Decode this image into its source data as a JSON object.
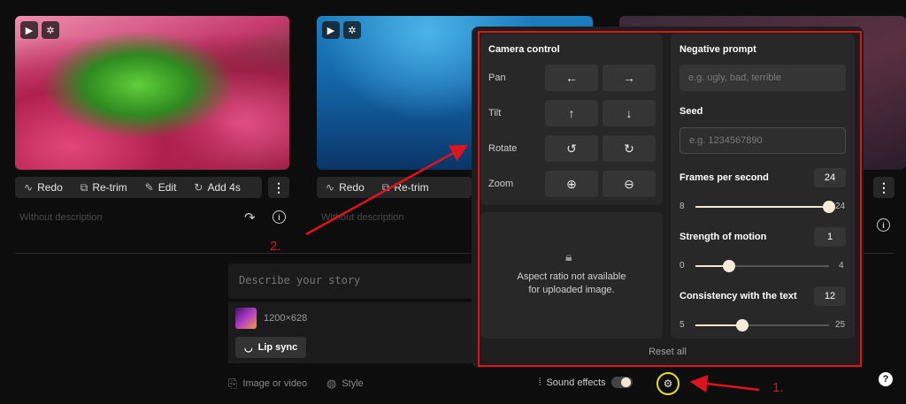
{
  "cards": [
    {
      "actions": [
        {
          "icon": "waveform-icon",
          "label": "Redo"
        },
        {
          "icon": "retrim-icon",
          "label": "Re-trim"
        },
        {
          "icon": "brush-icon",
          "label": "Edit"
        },
        {
          "icon": "rotate-clock-icon",
          "label": "Add 4s"
        }
      ],
      "description": "Without description"
    },
    {
      "actions": [
        {
          "icon": "waveform-icon",
          "label": "Redo"
        },
        {
          "icon": "retrim-icon",
          "label": "Re-trim"
        }
      ],
      "description": "Without description"
    }
  ],
  "prompt": {
    "placeholder": "Describe your story",
    "attachment_dims": "1200×628",
    "lip_sync_label": "Lip sync"
  },
  "bottom_bar": {
    "image_or_video": "Image or video",
    "style": "Style",
    "sound_effects": "Sound effects",
    "sound_effects_on": false
  },
  "camera": {
    "title": "Camera control",
    "rows": [
      {
        "label": "Pan",
        "left": "←",
        "right": "→"
      },
      {
        "label": "Tilt",
        "left": "↑",
        "right": "↓"
      },
      {
        "label": "Rotate",
        "left": "↺",
        "right": "↻"
      },
      {
        "label": "Zoom",
        "left": "⊕",
        "right": "⊖"
      }
    ]
  },
  "aspect": {
    "line1": "Aspect ratio not available",
    "line2": "for uploaded image."
  },
  "settings": {
    "negative_prompt_label": "Negative prompt",
    "negative_prompt_placeholder": "e.g. ugly, bad, terrible",
    "seed_label": "Seed",
    "seed_placeholder": "e.g. 1234567890",
    "fps": {
      "label": "Frames per second",
      "value": "24",
      "min": "8",
      "max": "24",
      "num": 24,
      "lo": 8,
      "hi": 24
    },
    "motion": {
      "label": "Strength of motion",
      "value": "1",
      "min": "0",
      "max": "4",
      "num": 1,
      "lo": 0,
      "hi": 4
    },
    "consistency": {
      "label": "Consistency with the text",
      "value": "12",
      "min": "5",
      "max": "25",
      "num": 12,
      "lo": 5,
      "hi": 25
    },
    "reset_label": "Reset all"
  },
  "annotations": {
    "step1": "1.",
    "step2": "2."
  },
  "accent": {
    "outline_red": "#e0131d",
    "highlight_yellow": "#e6e01a",
    "slider": "#f3e6cf"
  }
}
